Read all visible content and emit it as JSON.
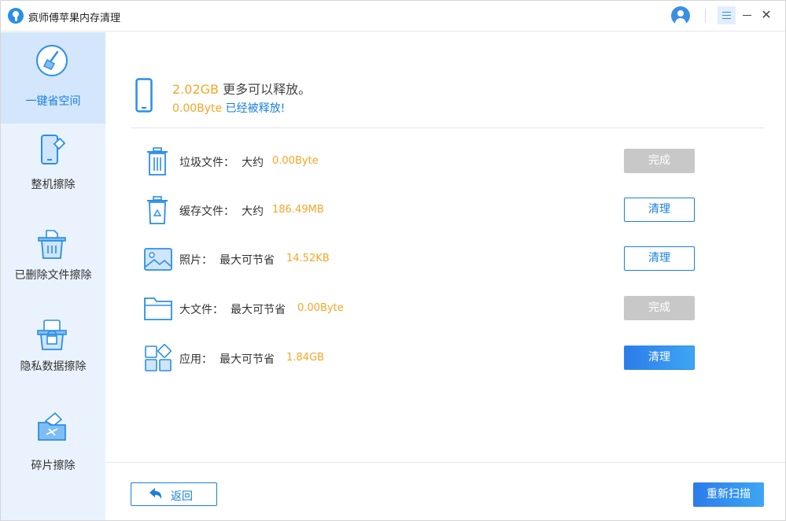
{
  "app": {
    "title": "疯师傅苹果内存清理"
  },
  "sidebar": {
    "items": [
      {
        "label": "一键省空间",
        "icon": "broom-icon",
        "active": true
      },
      {
        "label": "整机擦除",
        "icon": "phone-erase-icon",
        "active": false
      },
      {
        "label": "已删除文件擦除",
        "icon": "deleted-file-trash-icon",
        "active": false
      },
      {
        "label": "隐私数据擦除",
        "icon": "privacy-lock-icon",
        "active": false
      },
      {
        "label": "碎片擦除",
        "icon": "fragment-folder-icon",
        "active": false
      }
    ]
  },
  "summary": {
    "freeable_size": "2.02GB",
    "freeable_text": "更多可以释放。",
    "freed_size": "0.00Byte",
    "freed_text": "已经被释放!"
  },
  "items": [
    {
      "name": "垃圾文件：",
      "qualifier": "大约",
      "size": "0.00Byte",
      "button": "完成",
      "state": "done",
      "icon": "trash-icon"
    },
    {
      "name": "缓存文件：",
      "qualifier": "大约",
      "size": "186.49MB",
      "button": "清理",
      "state": "outline",
      "icon": "cache-bin-icon"
    },
    {
      "name": "照片：",
      "qualifier": "最大可节省",
      "size": "14.52KB",
      "button": "清理",
      "state": "outline",
      "icon": "photo-icon"
    },
    {
      "name": "大文件：",
      "qualifier": "最大可节省",
      "size": "0.00Byte",
      "button": "完成",
      "state": "done",
      "icon": "folder-icon"
    },
    {
      "name": "应用：",
      "qualifier": "最大可节省",
      "size": "1.84GB",
      "button": "清理",
      "state": "solid",
      "icon": "apps-icon"
    }
  ],
  "footer": {
    "back_label": "返回",
    "rescan_label": "重新扫描"
  },
  "colors": {
    "accent": "#1a7fe0",
    "highlight": "#f5a623",
    "sidebar_bg": "#eaf3fd",
    "sidebar_active": "#d3e6fb",
    "done_gray": "#c8c8c8"
  }
}
